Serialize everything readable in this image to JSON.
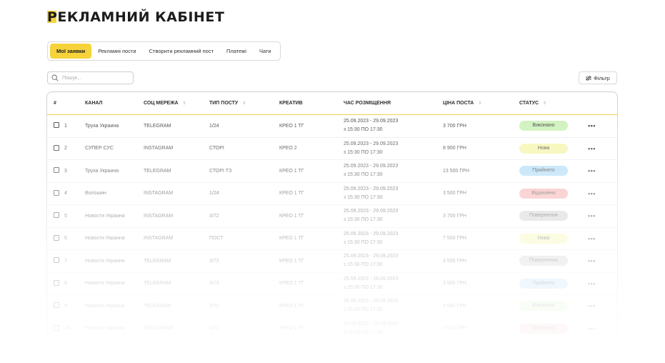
{
  "page": {
    "title": "РЕКЛАМНИЙ КАБІНЕТ"
  },
  "tabs": [
    {
      "label": "Мої заявки",
      "active": true
    },
    {
      "label": "Рекламні пости",
      "active": false
    },
    {
      "label": "Створити рекламний пост",
      "active": false
    },
    {
      "label": "Платежі",
      "active": false
    },
    {
      "label": "Чати",
      "active": false
    }
  ],
  "search": {
    "placeholder": "Пошук...",
    "value": ""
  },
  "filter": {
    "label": "Фільтр"
  },
  "table": {
    "columns": {
      "num": "#",
      "channel": "КАНАЛ",
      "network": "СОЦ МЕРЕЖА",
      "post_type": "ТИП ПОСТУ",
      "creative": "КРЕАТИВ",
      "time": "ЧАС РОЗМІЩЕННЯ",
      "price": "ЦІНА ПОСТА",
      "status": "СТАТУС"
    },
    "rows": [
      {
        "num": "1",
        "channel": "Труха Украина",
        "network": "TELEGRAM",
        "post_type": "1/24",
        "creative": "КРЕО 1 ТГ",
        "time_line1": "25.09.2023 - 29.09.2023",
        "time_line2": "з 15:30 ПО 17:30",
        "price": "3 700 ГРН",
        "status": "Виконано",
        "status_color": "#c8f0b4",
        "opacity": 1
      },
      {
        "num": "2",
        "channel": "СУПЕР СУС",
        "network": "INSTAGRAM",
        "post_type": "СТОРІ",
        "creative": "КРЕО 2",
        "time_line1": "25.09.2023 - 29.09.2023",
        "time_line2": "з 15:30 ПО 17:30",
        "price": "8 900 ГРН",
        "status": "Нова",
        "status_color": "#f4f5a6",
        "opacity": 1
      },
      {
        "num": "3",
        "channel": "Труха Украина",
        "network": "TELEGRAM",
        "post_type": "СТОРІ ТЗ",
        "creative": "КРЕО 1 ТГ",
        "time_line1": "25.09.2023 - 29.09.2023",
        "time_line2": "з 15:30 ПО 17:30",
        "price": "13 500 ГРН",
        "status": "Прийнято",
        "status_color": "#a9d9f7",
        "opacity": 1
      },
      {
        "num": "4",
        "channel": "Волошин",
        "network": "INSTAGRAM",
        "post_type": "1/24",
        "creative": "КРЕО 1 ТГ",
        "time_line1": "25.09.2023 - 29.09.2023",
        "time_line2": "з 15:30 ПО 17:30",
        "price": "3 500 ГРН",
        "status": "Відхилено",
        "status_color": "#f7a6a6",
        "opacity": 1
      },
      {
        "num": "5",
        "channel": "Новости Украина",
        "network": "INSTAGRAM",
        "post_type": "3/72",
        "creative": "КРЕО 1 ТГ",
        "time_line1": "25.09.2023 - 29.09.2023",
        "time_line2": "з 15:30 ПО 17:30",
        "price": "3 700 ГРН",
        "status": "Повернення",
        "status_color": "#c9c9c9",
        "opacity": 1
      },
      {
        "num": "6",
        "channel": "Новости Украина",
        "network": "INSTAGRAM",
        "post_type": "ПОСТ",
        "creative": "КРЕО 1 ТГ",
        "time_line1": "25.09.2023 - 29.09.2023",
        "time_line2": "з 15:30 ПО 17:30",
        "price": "7 500 ГРН",
        "status": "Нова",
        "status_color": "#f4f5a6",
        "opacity": 1
      },
      {
        "num": "7",
        "channel": "Новости Украина",
        "network": "TELEGRAM",
        "post_type": "3/72",
        "creative": "КРЕО 1 ТГ",
        "time_line1": "25.09.2023 - 29.09.2023",
        "time_line2": "з 15:30 ПО 17:30",
        "price": "3 500 ГРН",
        "status": "Повернення",
        "status_color": "#c9c9c9",
        "opacity": 1
      },
      {
        "num": "8",
        "channel": "Новости Украина",
        "network": "TELEGRAM",
        "post_type": "3/72",
        "creative": "КРЕО 1 ТГ",
        "time_line1": "25.09.2023 - 29.09.2023",
        "time_line2": "з 15:30 ПО 17:30",
        "price": "3 500 ГРН",
        "status": "Прийнято",
        "status_color": "#a9d9f7",
        "opacity": 1
      },
      {
        "num": "9",
        "channel": "Новости Украина",
        "network": "TELEGRAM",
        "post_type": "3/72",
        "creative": "КРЕО 1 ТГ",
        "time_line1": "25.09.2023 - 29.09.2023",
        "time_line2": "з 15:30 ПО 17:30",
        "price": "3 500 ГРН",
        "status": "Виконано",
        "status_color": "#c8f0b4",
        "opacity": 1
      },
      {
        "num": "10",
        "channel": "Новости Украина",
        "network": "INSTAGRAM",
        "post_type": "3/72",
        "creative": "КРЕО 1 ТГ",
        "time_line1": "25.09.2023 - 29.09.2023",
        "time_line2": "з 15:30 ПО 17:30",
        "price": "3 500 ГРН",
        "status": "Відхилено",
        "status_color": "#f7a6a6",
        "opacity": 1
      }
    ]
  },
  "colors": {
    "accent": "#f6d33b",
    "border": "#cfcfcf"
  },
  "icons": {
    "search": "search-icon",
    "filter": "filter-sliders-icon",
    "more": "more-dots-icon",
    "sort": "sort-arrows-icon"
  }
}
